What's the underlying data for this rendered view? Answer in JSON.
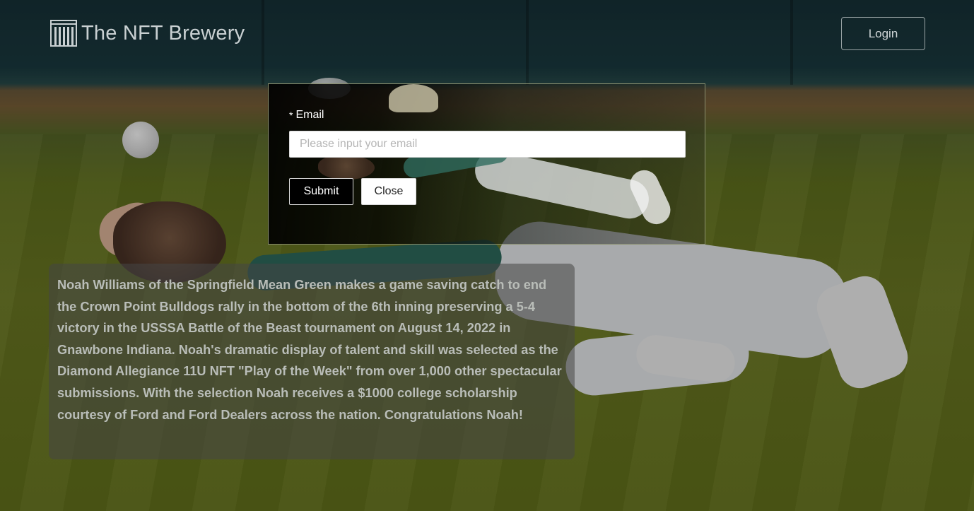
{
  "header": {
    "brand": "The NFT Brewery",
    "login_label": "Login"
  },
  "modal": {
    "required_mark": "*",
    "email_label": "Email",
    "email_placeholder": "Please input your email",
    "email_value": "",
    "submit_label": "Submit",
    "close_label": "Close"
  },
  "description": {
    "text": "Noah Williams of the Springfield Mean Green makes a game saving catch to end the Crown Point Bulldogs rally in the bottom of the 6th inning preserving a 5-4 victory in the USSSA Battle of the Beast tournament on August 14, 2022 in Gnawbone Indiana. Noah's dramatic display of talent and skill was selected as the Diamond Allegiance 11U NFT \"Play of the Week\" from over 1,000 other spectacular submissions. With the selection Noah receives a $1000 college scholarship courtesy of Ford and Ford Dealers across the nation. Congratulations Noah!"
  },
  "icons": {
    "logo": "brewery-logo-icon"
  },
  "colors": {
    "login_border": "#9aa4a6",
    "submit_bg": "#000000",
    "card_bg": "rgba(70,70,70,0.55)"
  }
}
